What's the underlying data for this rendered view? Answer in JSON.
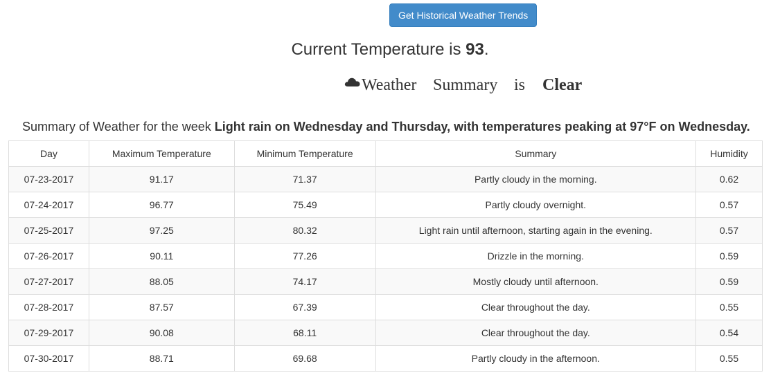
{
  "header": {
    "button_label": "Get Historical Weather Trends",
    "current_temp_prefix": "Current Temperature is",
    "current_temp_value": "93",
    "current_temp_suffix": ".",
    "weather_summary_words": [
      "Weather",
      "Summary",
      "is"
    ],
    "weather_summary_value": "Clear",
    "weather_icon": "cloud-icon"
  },
  "week": {
    "prefix": "Summary of Weather for the week",
    "summary": "Light rain on Wednesday and Thursday, with temperatures peaking at 97°F on Wednesday."
  },
  "table": {
    "columns": [
      "Day",
      "Maximum Temperature",
      "Minimum Temperature",
      "Summary",
      "Humidity"
    ],
    "rows": [
      {
        "day": "07-23-2017",
        "max": "91.17",
        "min": "71.37",
        "summary": "Partly cloudy in the morning.",
        "humidity": "0.62"
      },
      {
        "day": "07-24-2017",
        "max": "96.77",
        "min": "75.49",
        "summary": "Partly cloudy overnight.",
        "humidity": "0.57"
      },
      {
        "day": "07-25-2017",
        "max": "97.25",
        "min": "80.32",
        "summary": "Light rain until afternoon, starting again in the evening.",
        "humidity": "0.57"
      },
      {
        "day": "07-26-2017",
        "max": "90.11",
        "min": "77.26",
        "summary": "Drizzle in the morning.",
        "humidity": "0.59"
      },
      {
        "day": "07-27-2017",
        "max": "88.05",
        "min": "74.17",
        "summary": "Mostly cloudy until afternoon.",
        "humidity": "0.59"
      },
      {
        "day": "07-28-2017",
        "max": "87.57",
        "min": "67.39",
        "summary": "Clear throughout the day.",
        "humidity": "0.55"
      },
      {
        "day": "07-29-2017",
        "max": "90.08",
        "min": "68.11",
        "summary": "Clear throughout the day.",
        "humidity": "0.54"
      },
      {
        "day": "07-30-2017",
        "max": "88.71",
        "min": "69.68",
        "summary": "Partly cloudy in the afternoon.",
        "humidity": "0.55"
      }
    ]
  }
}
